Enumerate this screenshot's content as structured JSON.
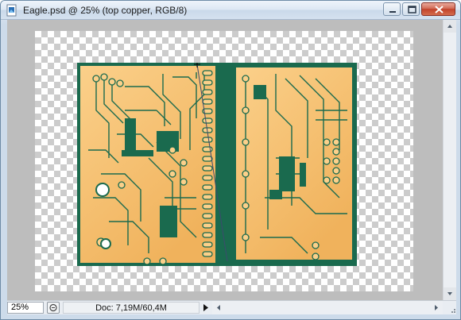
{
  "window": {
    "title": "Eagle.psd @ 25% (top copper, RGB/8)",
    "icon": "photoshop-document-icon",
    "controls": [
      "minimize-icon",
      "maximize-icon",
      "close-icon"
    ]
  },
  "canvas": {
    "background": "transparency-checkerboard",
    "content": "pcb-top-copper-layer",
    "colors": {
      "board_green": "#1a6a4e",
      "copper_light": "#f8c77c",
      "copper_dark": "#f0b55f",
      "workspace_gray": "#bdbdbd"
    }
  },
  "statusbar": {
    "zoom": "25%",
    "doc_info": "Doc: 7,19M/60,4M"
  }
}
